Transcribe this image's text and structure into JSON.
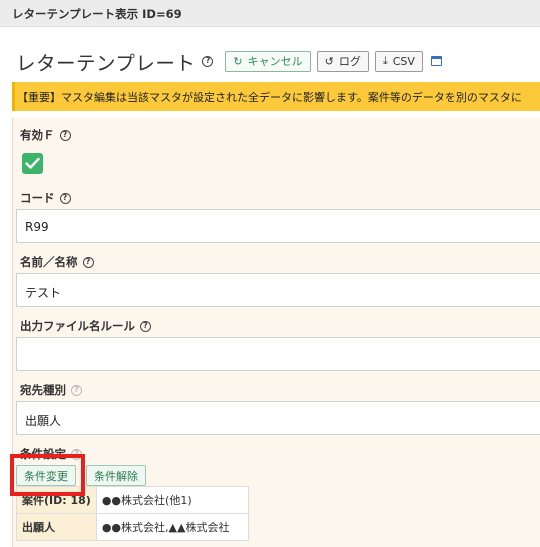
{
  "topbar": {
    "title": "レターテンプレート表示 ID=69"
  },
  "header": {
    "title": "レターテンプレート",
    "cancel_label": "キャンセル",
    "log_label": "ログ",
    "csv_label": "CSV"
  },
  "alert": {
    "text": "【重要】マスタ編集は当該マスタが設定された全データに影響します。案件等のデータを別のマスタに"
  },
  "form": {
    "active": {
      "label": "有効Ｆ",
      "checked": true
    },
    "code": {
      "label": "コード",
      "value": "R99"
    },
    "name": {
      "label": "名前／名称",
      "value": "テスト"
    },
    "file_rule": {
      "label": "出力ファイル名ルール",
      "value": ""
    },
    "dest_type": {
      "label": "宛先種別",
      "value": "出願人"
    },
    "conditions": {
      "label": "条件設定",
      "change_label": "条件変更",
      "clear_label": "条件解除",
      "rows": [
        {
          "key": "案件(ID: 18)",
          "value": "●●株式会社(他1)"
        },
        {
          "key": "出願人",
          "value": "●●株式会社,▲▲株式会社"
        }
      ]
    }
  },
  "colors": {
    "accent_green": "#3cb56b",
    "alert_yellow": "#fcc93a",
    "highlight_red": "#e8211e",
    "panel_bg": "#fdf6ec"
  }
}
